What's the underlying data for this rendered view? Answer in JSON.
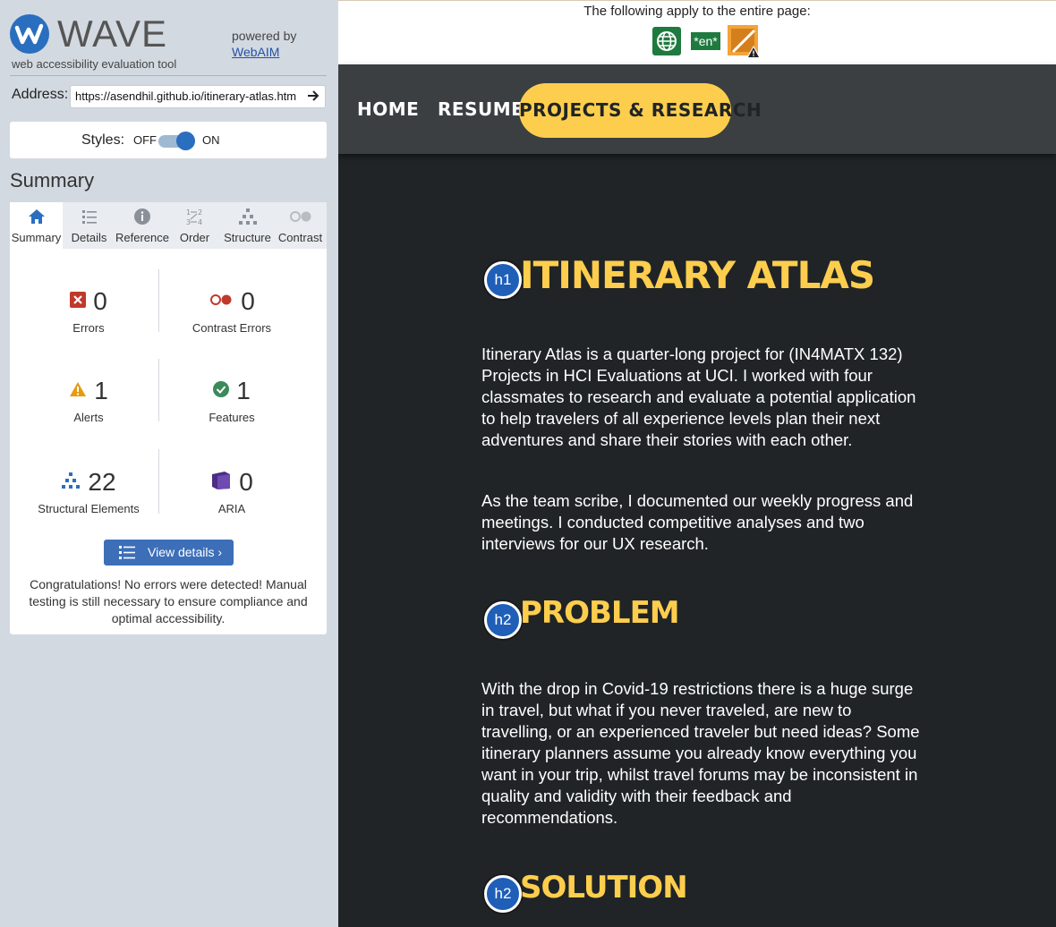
{
  "wave": {
    "logo_text": "WAVE",
    "tagline": "web accessibility evaluation tool",
    "powered_by": "powered by",
    "webaim_link": "WebAIM",
    "address_label": "Address:",
    "address_value": "https://asendhil.github.io/itinerary-atlas.htm",
    "styles_label": "Styles:",
    "styles_off": "OFF",
    "styles_on": "ON",
    "styles_state": "on",
    "summary_heading": "Summary",
    "tabs": [
      {
        "label": "Summary",
        "icon": "home-icon",
        "active": true
      },
      {
        "label": "Details",
        "icon": "list-icon"
      },
      {
        "label": "Reference",
        "icon": "info-icon"
      },
      {
        "label": "Order",
        "icon": "order-icon"
      },
      {
        "label": "Structure",
        "icon": "structure-icon"
      },
      {
        "label": "Contrast",
        "icon": "contrast-icon"
      }
    ],
    "stats": {
      "errors": {
        "count": "0",
        "label": "Errors"
      },
      "contrast_errors": {
        "count": "0",
        "label": "Contrast Errors"
      },
      "alerts": {
        "count": "1",
        "label": "Alerts"
      },
      "features": {
        "count": "1",
        "label": "Features"
      },
      "structural": {
        "count": "22",
        "label": "Structural Elements"
      },
      "aria": {
        "count": "0",
        "label": "ARIA"
      }
    },
    "view_details": "View details ›",
    "congrats": "Congratulations! No errors were detected! Manual testing is still necessary to ensure compliance and optimal accessibility."
  },
  "page_icons": {
    "caption": "The following apply to the entire page:",
    "lang_badge": "*en*"
  },
  "nav": {
    "home": "HOME",
    "resume": "RESUME",
    "projects": "PROJECTS & RESEARCH"
  },
  "content": {
    "h1_badge": "h1",
    "h1": "ITINERARY ATLAS",
    "intro_p1": "Itinerary Atlas is a quarter-long project for (IN4MATX 132) Projects in HCI Evaluations at UCI. I worked with four classmates to research and evaluate a potential application to help travelers of all experience levels plan their next adventures and share their stories with each other.",
    "intro_p2": "As the team scribe, I documented our weekly progress and meetings. I conducted competitive analyses and two interviews for our UX research.",
    "problem_badge": "h2",
    "problem_heading": "PROBLEM",
    "problem_p": "With the drop in Covid-19 restrictions there is a huge surge in travel, but what if you never traveled, are new to travelling, or an experienced traveler but need ideas? Some itinerary planners assume you already know everything you want in your trip, whilst travel forums may be inconsistent in quality and validity with their feedback and recommendations.",
    "solution_badge": "h2",
    "solution_heading": "SOLUTION"
  },
  "colors": {
    "accent": "#fdce4d",
    "page_bg": "#202427",
    "nav_bg": "#3b3f42",
    "wave_blue": "#2a6ebf",
    "sidebar_bg": "#d3d9e1"
  }
}
